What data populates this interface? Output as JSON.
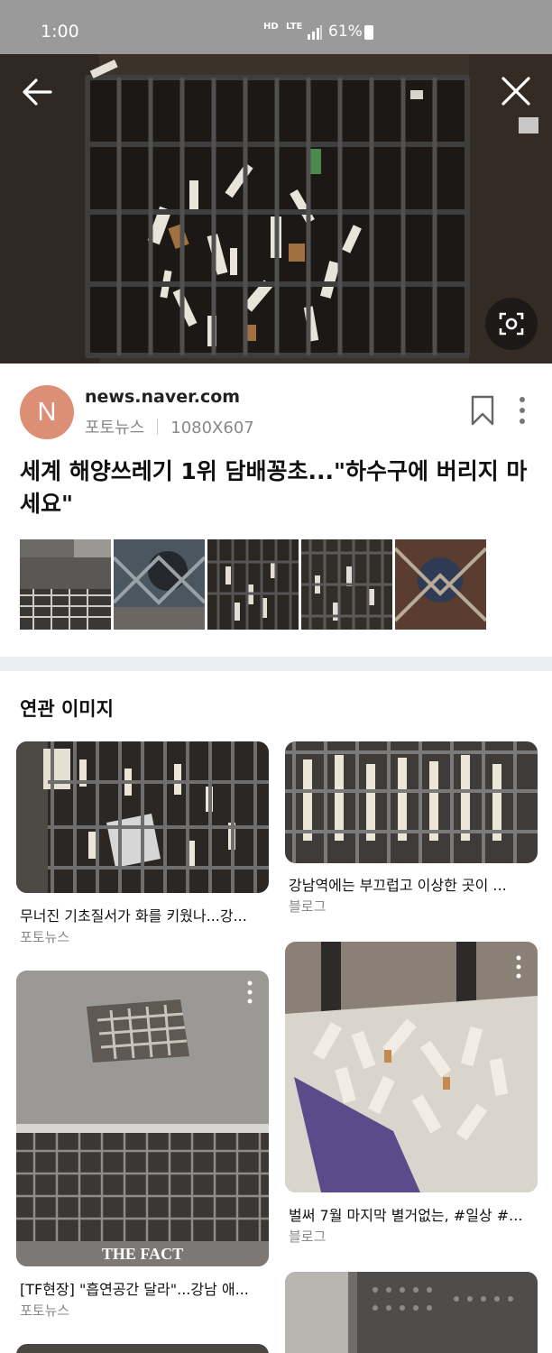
{
  "status": {
    "time": "1:00",
    "net_hd": "HD",
    "net_lte": "LTE",
    "battery": "61%"
  },
  "source": {
    "avatar_letter": "N",
    "domain": "news.naver.com",
    "category": "포토뉴스",
    "dimensions": "1080X607"
  },
  "article": {
    "title": "세계 해양쓰레기 1위 담배꽁초...\"하수구에 버리지 마세요\""
  },
  "related": {
    "heading": "연관 이미지",
    "cards": [
      {
        "caption": "무너진 기초질서가 화를 키웠나...강...",
        "source": "포토뉴스"
      },
      {
        "caption": "강남역에는 부끄럽고 이상한 곳이 ...",
        "source": "블로그"
      },
      {
        "caption": "[TF현장] \"흡연공간 달라\"...강남 애...",
        "source": "포토뉴스",
        "watermark": "THE FACT"
      },
      {
        "caption": "벌써 7월 마지막 별거없는, #일상 #...",
        "source": "블로그"
      }
    ]
  },
  "icons": [
    "back-arrow-icon",
    "close-icon",
    "lens-search-icon",
    "bookmark-icon",
    "more-vertical-icon",
    "signal-icon",
    "battery-icon"
  ]
}
